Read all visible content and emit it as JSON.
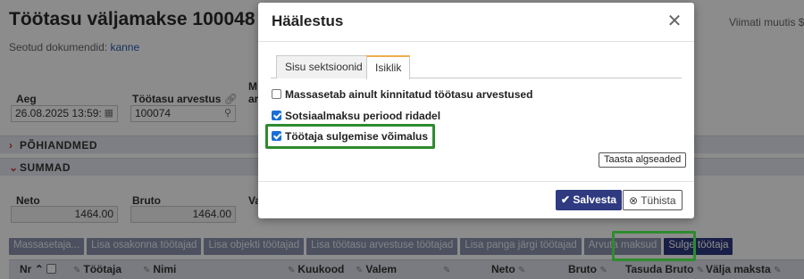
{
  "page": {
    "title": "Töötasu väljamakse 100048",
    "last_changed": "Viimati muutis $",
    "related_label": "Seotud dokumendid:",
    "related_link": "kanne"
  },
  "fields": {
    "aeg_label": "Aeg",
    "aeg_value": "26.08.2025 13:59:",
    "arvestus_label": "Töötasu arvestus",
    "arvestus_value": "100074",
    "m_label_1": "M",
    "m_label_2": "ar",
    "neto_label": "Neto",
    "neto_value": "1464.00",
    "bruto_label": "Bruto",
    "bruto_value": "1464.00",
    "va_label": "Va"
  },
  "sections": {
    "pohiandmed": "PÕHIANDMED",
    "summad": "SUMMAD"
  },
  "action_buttons": [
    "Massasetaja...",
    "Lisa osakonna töötajad",
    "Lisa objekti töötajad",
    "Lisa töötasu arvestuse töötajad",
    "Lisa panga järgi töötajad",
    "Arvuta maksud",
    "Sulge töötaja"
  ],
  "table_headers": {
    "nr": "Nr",
    "tootaja": "Töötaja",
    "nimi": "Nimi",
    "kuukood": "Kuukood",
    "valem": "Valem",
    "neto": "Neto",
    "bruto": "Bruto",
    "tasuda_bruto": "Tasuda Bruto",
    "valja_maksta": "Välja maksta"
  },
  "modal": {
    "title": "Häälestus",
    "tabs": [
      "Sisu sektsioonid",
      "Isiklik"
    ],
    "options": [
      {
        "label": "Massasetab ainult kinnitatud töötasu arvestused",
        "checked": false
      },
      {
        "label": "Sotsiaalmaksu periood ridadel",
        "checked": true
      },
      {
        "label": "Töötaja sulgemise võimalus",
        "checked": true
      }
    ],
    "reset_label": "Taasta algseaded",
    "save_label": "Salvesta",
    "cancel_label": "Tühista"
  },
  "icons": {
    "close": "close-icon",
    "calendar": "calendar-icon",
    "search": "search-icon",
    "check": "check-icon",
    "cancel": "cancel-circle-icon"
  },
  "colors": {
    "primary_button": "#2f3a80",
    "highlight": "#2e8b2e",
    "tab_accent": "#f0ad4e",
    "checkbox": "#1a6fd6"
  }
}
